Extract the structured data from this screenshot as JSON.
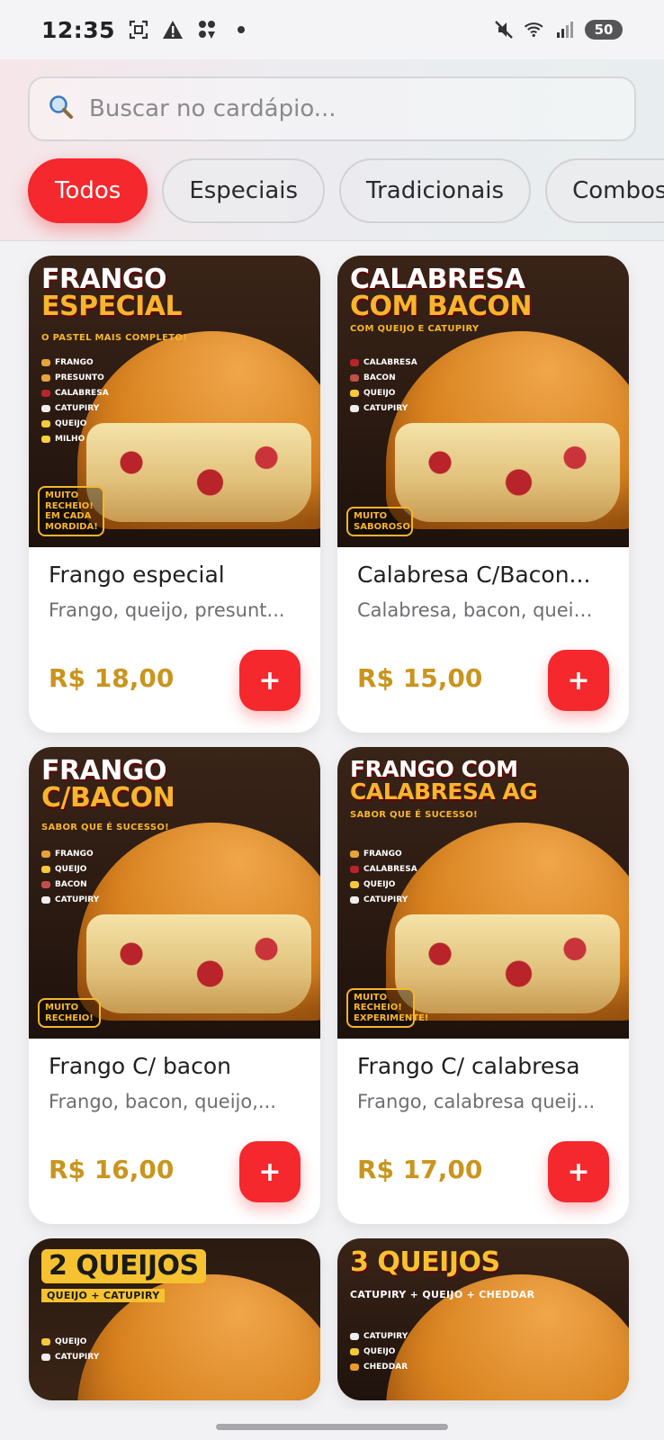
{
  "status_bar": {
    "time": "12:35",
    "battery": "50",
    "icons_left": [
      "screenshot-icon",
      "warning-icon",
      "app-icon",
      "dot-icon"
    ],
    "icons_right": [
      "mute-icon",
      "wifi-icon",
      "signal-icon",
      "battery-icon"
    ]
  },
  "search": {
    "placeholder": "Buscar no cardápio..."
  },
  "categories": [
    {
      "label": "Todos",
      "active": true
    },
    {
      "label": "Especiais",
      "active": false
    },
    {
      "label": "Tradicionais",
      "active": false
    },
    {
      "label": "Combos",
      "active": false
    }
  ],
  "products": [
    {
      "name": "Frango especial",
      "description": "Frango, queijo, presunt...",
      "price": "R$ 18,00",
      "add_label": "+",
      "image": {
        "title_line1": "FRANGO",
        "title_line2": "ESPECIAL",
        "subtitle": "O PASTEL MAIS COMPLETO!",
        "ingredients": [
          "FRANGO",
          "PRESUNTO",
          "CALABRESA",
          "CATUPIRY",
          "QUEIJO",
          "MILHO"
        ],
        "badge": "MUITO RECHEIO! EM CADA MORDIDA!"
      }
    },
    {
      "name": "Calabresa C/Bacon...",
      "description": "Calabresa, bacon, queij...",
      "price": "R$ 15,00",
      "add_label": "+",
      "image": {
        "title_line1": "CALABRESA",
        "title_line2": "COM BACON",
        "subtitle": "COM QUEIJO E CATUPIRY",
        "ingredients": [
          "CALABRESA",
          "BACON",
          "QUEIJO",
          "CATUPIRY"
        ],
        "badge": "MUITO SABOROSO"
      }
    },
    {
      "name": "Frango C/ bacon",
      "description": "Frango, bacon, queijo,...",
      "price": "R$ 16,00",
      "add_label": "+",
      "image": {
        "title_line1": "FRANGO",
        "title_line2": "C/BACON",
        "subtitle": "SABOR QUE É SUCESSO!",
        "ingredients": [
          "FRANGO",
          "QUEIJO",
          "BACON",
          "CATUPIRY"
        ],
        "badge": "MUITO RECHEIO!"
      }
    },
    {
      "name": "Frango C/ calabresa",
      "description": "Frango, calabresa queij...",
      "price": "R$ 17,00",
      "add_label": "+",
      "image": {
        "title_line1": "FRANGO COM",
        "title_line2": "CALABRESA AG",
        "subtitle": "SABOR QUE É SUCESSO!",
        "ingredients": [
          "FRANGO",
          "CALABRESA",
          "QUEIJO",
          "CATUPIRY"
        ],
        "badge": "MUITO RECHEIO! EXPERIMENTE!"
      }
    },
    {
      "image": {
        "title_line1": "2 QUEIJOS",
        "title_line2": "",
        "subtitle": "QUEIJO + CATUPIRY",
        "ingredients": [
          "QUEIJO",
          "CATUPIRY"
        ]
      }
    },
    {
      "image": {
        "title_line1": "3 QUEIJOS",
        "title_line2": "",
        "subtitle": "CATUPIRY + QUEIJO + CHEDDAR",
        "ingredients": [
          "CATUPIRY",
          "QUEIJO",
          "CHEDDAR"
        ]
      }
    }
  ],
  "colors": {
    "accent": "#f4282d",
    "price": "#c9951e",
    "image_title": "#f6b52d"
  }
}
